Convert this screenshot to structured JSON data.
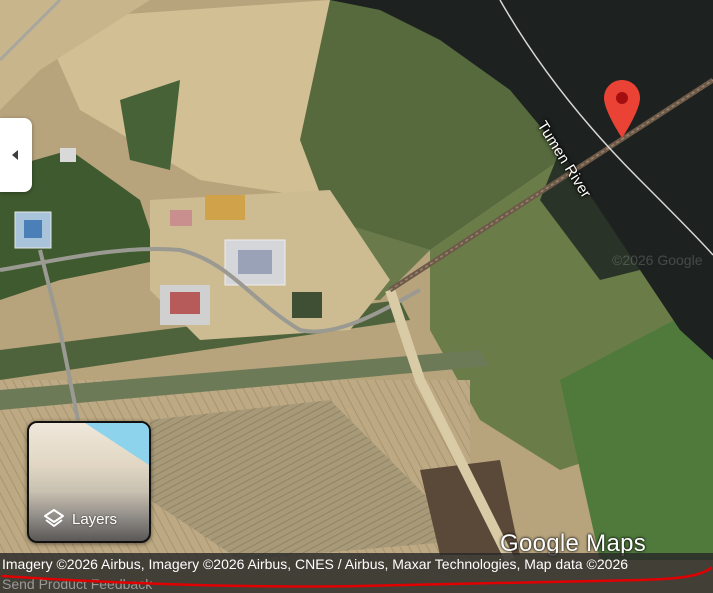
{
  "map": {
    "view": "satellite",
    "colors": {
      "water": "#1d211f",
      "field": "#c9b58a",
      "vegetation": "#5b6e3a",
      "pin": "#ea4335"
    },
    "place_label": "Tumen River",
    "faint_watermark": "©2026 Google"
  },
  "controls": {
    "collapse_icon": "chevron-left-icon",
    "layers_label": "Layers",
    "layers_icon": "layers-icon"
  },
  "branding": {
    "logo_text": "Google Maps"
  },
  "footer": {
    "attribution": "Imagery ©2026 Airbus, Imagery ©2026 Airbus, CNES / Airbus, Maxar Technologies, Map data ©2026",
    "feedback_link": "Send Product Feedback"
  },
  "annotation": {
    "underline_color": "#e00000"
  }
}
